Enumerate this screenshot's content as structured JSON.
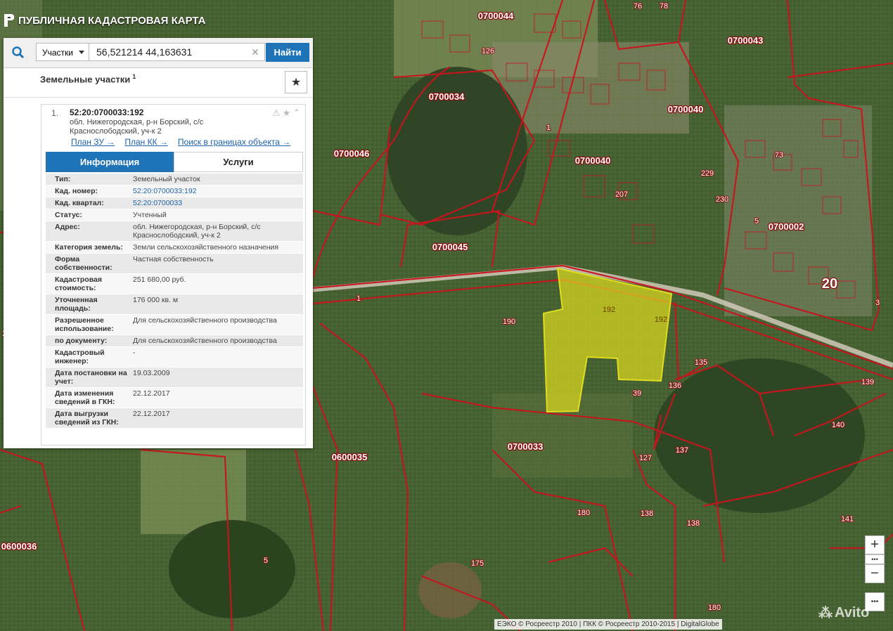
{
  "app": {
    "title": "ПУБЛИЧНАЯ КАДАСТРОВАЯ КАРТА"
  },
  "search": {
    "type_label": "Участки",
    "query": "56,521214 44,163631",
    "find_label": "Найти"
  },
  "results": {
    "title": "Земельные участки",
    "count": "1",
    "item": {
      "index": "1.",
      "cad_number": "52:20:0700033:192",
      "address": "обл. Нижегородская, р-н Борский, с/с Краснослободский, уч-к 2",
      "links": [
        "План ЗУ →",
        "План КК →",
        "Поиск в границах объекта →"
      ],
      "tabs": {
        "info": "Информация",
        "services": "Услуги"
      },
      "details": [
        {
          "key": "Тип:",
          "value": "Земельный участок"
        },
        {
          "key": "Кад. номер:",
          "value": "52:20:0700033:192",
          "link": true
        },
        {
          "key": "Кад. квартал:",
          "value": "52:20:0700033",
          "link": true
        },
        {
          "key": "Статус:",
          "value": "Учтенный"
        },
        {
          "key": "Адрес:",
          "value": "обл. Нижегородская, р-н Борский, с/с Краснослободский, уч-к 2"
        },
        {
          "key": "Категория земель:",
          "value": "Земли сельскохозяйственного назначения"
        },
        {
          "key": "Форма собственности:",
          "value": "Частная собственность"
        },
        {
          "key": "Кадастровая стоимость:",
          "value": "251 680,00 руб."
        },
        {
          "key": "Уточненная площадь:",
          "value": "176 000 кв. м"
        },
        {
          "key": "Разрешенное использование:",
          "value": "Для сельскохозяйственного производства"
        },
        {
          "key": "по документу:",
          "value": "Для сельскохозяйственного производства"
        },
        {
          "key": "Кадастровый инженер:",
          "value": "-"
        },
        {
          "key": "Дата постановки на учет:",
          "value": "19.03.2009"
        },
        {
          "key": "Дата изменения сведений в ГКН:",
          "value": "22.12.2017"
        },
        {
          "key": "Дата выгрузки сведений из ГКН:",
          "value": "22.12.2017"
        }
      ]
    }
  },
  "map": {
    "labels": [
      "0700044",
      "0700043",
      "0700034",
      "0700040",
      "0700046",
      "0700040",
      "0700002",
      "0700045",
      "0700033",
      "0600035",
      "0600036",
      "20",
      "1",
      "1",
      "13",
      "2",
      "192",
      "192",
      "190",
      "207",
      "230",
      "229",
      "135",
      "136",
      "39",
      "139",
      "140",
      "137",
      "127",
      "180",
      "138",
      "138",
      "141",
      "175",
      "180",
      "5",
      "76",
      "78",
      "73",
      "126",
      "5",
      "3"
    ],
    "selected_color": "#e0dc1e",
    "boundary_color": "#c8141e"
  },
  "zoom": {
    "in": "+",
    "out": "−",
    "dots": "•••",
    "more": "•••"
  },
  "attribution": "ЕЭКО © Росреестр 2010 | ПКК © Росреестр 2010-2015 | DigitalGlobe",
  "watermark": "Avito"
}
